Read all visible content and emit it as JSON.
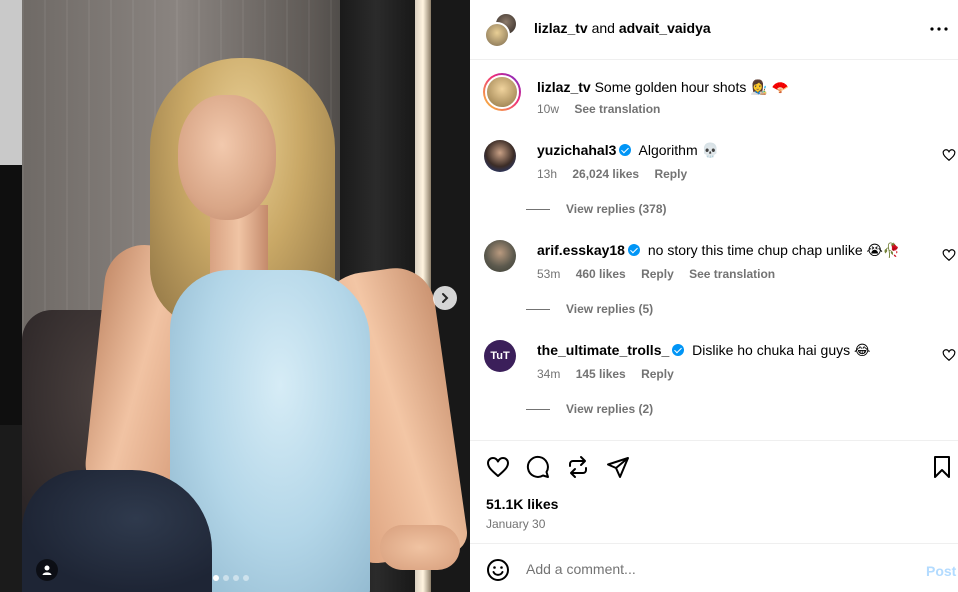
{
  "post": {
    "header": {
      "user1": "lizlaz_tv",
      "joiner": "and",
      "user2": "advait_vaidya"
    },
    "caption": {
      "user": "lizlaz_tv",
      "text": "Some golden hour shots 👩‍🎨 🪭",
      "time": "10w",
      "see_translation": "See translation"
    },
    "comments": [
      {
        "user": "yuzichahal3",
        "verified": true,
        "text": "Algorithm 💀",
        "time": "13h",
        "likes": "26,024 likes",
        "reply": "Reply",
        "view_replies": "View replies (378)"
      },
      {
        "user": "arif.esskay18",
        "verified": true,
        "text": "no story this time chup chap unlike 😭🥀",
        "time": "53m",
        "likes": "460 likes",
        "reply": "Reply",
        "see_translation": "See translation",
        "view_replies": "View replies (5)"
      },
      {
        "user": "the_ultimate_trolls_",
        "verified": true,
        "text": "Dislike ho chuka hai guys 😂",
        "time": "34m",
        "likes": "145 likes",
        "reply": "Reply",
        "view_replies": "View replies (2)",
        "avatar_text": "TuT"
      }
    ],
    "likes": "51.1K likes",
    "date": "January 30",
    "add_comment_placeholder": "Add a comment...",
    "post_button": "Post"
  },
  "icons": {
    "like": "heart-icon",
    "comment": "comment-icon",
    "repost": "repost-icon",
    "share": "share-icon",
    "save": "bookmark-icon",
    "more": "more-icon",
    "emoji": "emoji-icon",
    "next": "chevron-right-icon",
    "tag": "user-tag-icon"
  },
  "colors": {
    "verified": "#0095f6",
    "secondary_text": "#737373",
    "post_disabled": "#b3dbff"
  }
}
